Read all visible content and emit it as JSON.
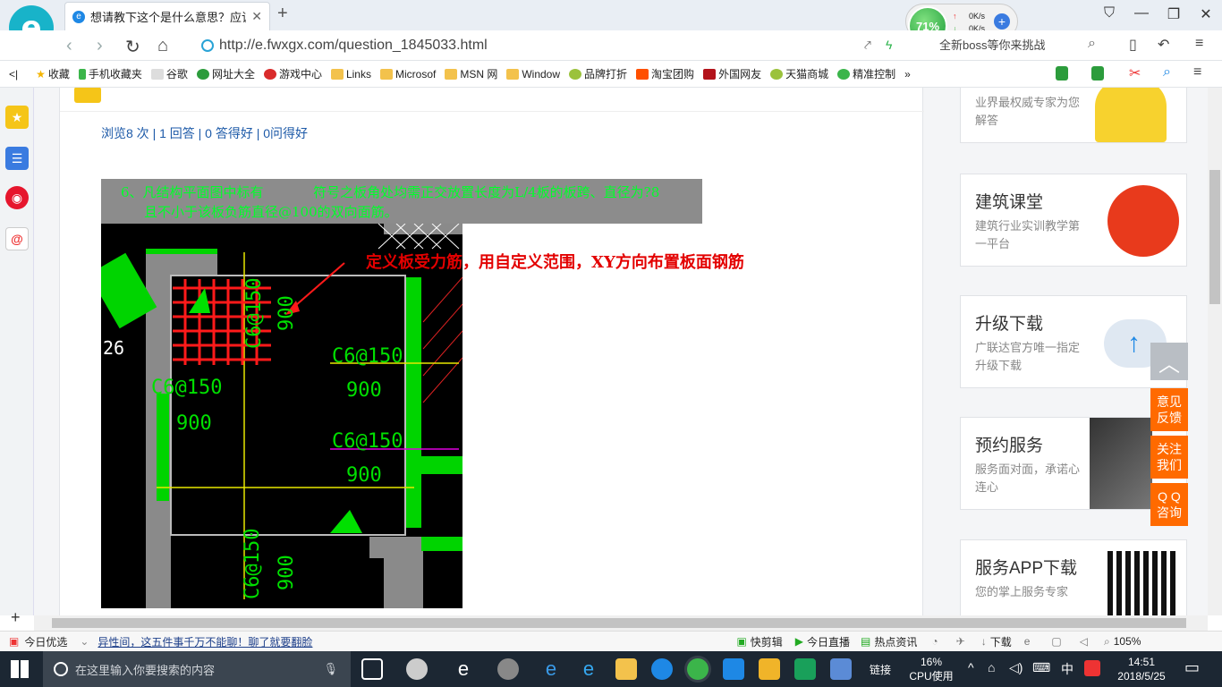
{
  "browser": {
    "tab_title": "想请教下这个是什么意思？应该怎么",
    "tab_favicon": "e",
    "logo": "e",
    "url": "http://e.fwxgx.com/question_1845033.html",
    "recommend": "全新boss等你来挑战",
    "speed": {
      "percent": "71%",
      "up": "0K/s",
      "down": "0K/s"
    }
  },
  "bookmarks": [
    {
      "label": "收藏",
      "icon": "star-icon"
    },
    {
      "label": "手机收藏夹",
      "icon": "phone-icon"
    },
    {
      "label": "谷歌",
      "icon": "page-icon"
    },
    {
      "label": "网址大全",
      "icon": "green-icon"
    },
    {
      "label": "游戏中心",
      "icon": "game-icon"
    },
    {
      "label": "Links",
      "icon": "folder-icon"
    },
    {
      "label": "Microsof",
      "icon": "folder-icon"
    },
    {
      "label": "MSN 网",
      "icon": "folder-icon"
    },
    {
      "label": "Window",
      "icon": "folder-icon"
    },
    {
      "label": "品牌打折",
      "icon": "leaf-icon"
    },
    {
      "label": "淘宝团购",
      "icon": "taobao-icon"
    },
    {
      "label": "外国网友",
      "icon": "flag-icon"
    },
    {
      "label": "天猫商城",
      "icon": "leaf-icon"
    },
    {
      "label": "精准控制",
      "icon": "chat-icon"
    }
  ],
  "question": {
    "stats": "浏览8 次 | 1 回答 | 0 答得好 | 0问得好",
    "image_caption_line1": "6、凡结构平面图中标有",
    "image_caption_line1b": "符号之板角处均需正交放置长度为L/4板的板跨、直径为?8",
    "image_caption_line2": "且不小于该板负筋直径@100的双向面筋。",
    "annotation": "定义板受力筋，用自定义范围，XY方向布置板面钢筋",
    "cad_labels": [
      "C6@150",
      "900",
      "C6@150",
      "900",
      "C6@150",
      "900",
      "C6@150",
      "900",
      "C6@150",
      "900",
      "26"
    ]
  },
  "sidebar_ads": [
    {
      "title": "",
      "subtitle": "业界最权威专家为您解答"
    },
    {
      "title": "建筑课堂",
      "subtitle": "建筑行业实训教学第一平台"
    },
    {
      "title": "升级下载",
      "subtitle": "广联达官方唯一指定升级下载"
    },
    {
      "title": "预约服务",
      "subtitle": "服务面对面，承诺心连心"
    },
    {
      "title": "服务APP下载",
      "subtitle": "您的掌上服务专家"
    }
  ],
  "float_tools": {
    "feedback": "意见反馈",
    "follow": "关注我们",
    "qq": "Q Q咨询"
  },
  "statusbar": {
    "today": "今日优选",
    "news": "异性间，这五件事千万不能聊！聊了就要翻脸",
    "kuaijianji": "快剪辑",
    "live": "今日直播",
    "hot": "热点资讯",
    "download": "下载",
    "zoom": "105%"
  },
  "taskbar": {
    "search_placeholder": "在这里输入你要搜索的内容",
    "network": "链接",
    "cpu_percent": "16%",
    "cpu_label": "CPU使用",
    "ime": "中",
    "time": "14:51",
    "date": "2018/5/25"
  },
  "colors": {
    "accent": "#1d5aa8",
    "orange": "#ff6a00",
    "cad_green": "#00e000",
    "cad_red": "#ff1a1a"
  }
}
